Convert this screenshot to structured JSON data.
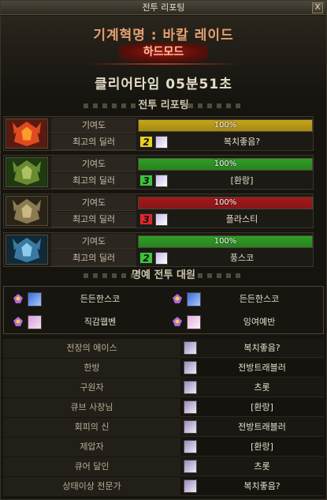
{
  "window": {
    "title": "전투 리포팅",
    "close_label": "X"
  },
  "header": {
    "raid_name": "기계혁명 : 바칼 레이드",
    "mode": "하드모드",
    "clear_time": "클리어타임  05분51초"
  },
  "report": {
    "section_title": "전투 리포팅",
    "contribution_label": "기여도",
    "top_dealer_label": "최고의 딜러",
    "rows": [
      {
        "boss_icon": "fire-dragon-icon",
        "progress_text": "100%",
        "progress": 1.0,
        "bar_color": "#c8a616",
        "rank": "2",
        "rank_color": "#e8d020",
        "dealer": "복치좋음?"
      },
      {
        "boss_icon": "earth-dragon-icon",
        "progress_text": "100%",
        "progress": 1.0,
        "bar_color": "#2f9e24",
        "rank": "3",
        "rank_color": "#3cc43a",
        "dealer": "[환랑]"
      },
      {
        "boss_icon": "dark-dragon-icon",
        "progress_text": "100%",
        "progress": 1.0,
        "bar_color": "#a5171b",
        "rank": "3",
        "rank_color": "#e0262c",
        "dealer": "플라스티"
      },
      {
        "boss_icon": "ice-dragon-icon",
        "progress_text": "100%",
        "progress": 1.0,
        "bar_color": "#2f9e24",
        "rank": "2",
        "rank_color": "#3cc43a",
        "dealer": "풍스코"
      }
    ]
  },
  "honor": {
    "section_title": "명예 전투 대원",
    "members": [
      "든든한스코",
      "든든한스코",
      "직감웹벤",
      "잉여예반"
    ]
  },
  "awards": [
    {
      "title": "전장의 에이스",
      "name": "복치좋음?"
    },
    {
      "title": "한방",
      "name": "전방트래블러"
    },
    {
      "title": "구원자",
      "name": "츠롯"
    },
    {
      "title": "큐브 사장님",
      "name": "[환랑]"
    },
    {
      "title": "회피의 신",
      "name": "전방트래블러"
    },
    {
      "title": "제압자",
      "name": "[환랑]"
    },
    {
      "title": "큐어 달인",
      "name": "츠롯"
    },
    {
      "title": "상태이상 전문가",
      "name": "복치좋음?"
    }
  ],
  "colors": {
    "accent_orange": "#e3a070",
    "mode_red": "#9a1a12"
  }
}
